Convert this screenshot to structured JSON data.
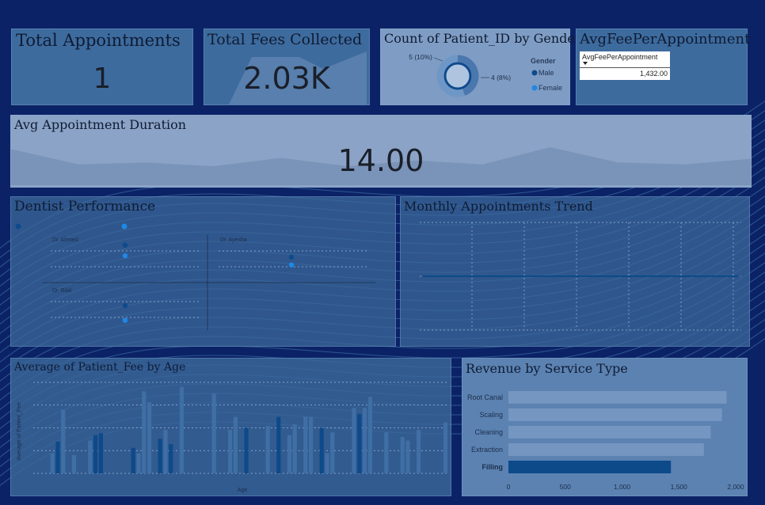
{
  "kpis": {
    "total_appointments": {
      "title": "Total Appointments",
      "value": "1"
    },
    "total_fees": {
      "title": "Total Fees Collected",
      "value": "2.03K"
    },
    "avg_duration": {
      "title": "Avg Appointment Duration",
      "value": "14.00"
    }
  },
  "avg_fee_card": {
    "title": "AvgFeePerAppointment",
    "table_header": "AvgFeePerAppointment",
    "sort_icon": "sort-desc-icon",
    "table_value": "1,432.00"
  },
  "colors": {
    "page_bg": "#0b2366",
    "card_bg": "#3d6b9e",
    "male": "#0e4a8c",
    "female": "#1f88e5",
    "bar": "#4f7cab",
    "bar_highlight": "#0d4a8a"
  },
  "chart_data": [
    {
      "type": "pie",
      "subtype": "donut",
      "title": "Count of Patient_ID by Gender",
      "legend_title": "Gender",
      "legend_position": "right",
      "categories": [
        "Male",
        "Female"
      ],
      "data_labels": [
        "4 (8%)",
        "5 (10%)"
      ],
      "values": [
        4,
        5
      ]
    },
    {
      "type": "bar",
      "orientation": "horizontal",
      "title": "Revenue by Service Type",
      "categories": [
        "Root Canal",
        "Scaling",
        "Cleaning",
        "Extraction",
        "Filling"
      ],
      "values": [
        1920,
        1880,
        1780,
        1720,
        1430
      ],
      "highlighted": "Filling",
      "xlim": [
        0,
        2000
      ],
      "xticks": [
        "0",
        "500",
        "1,000",
        "1,500",
        "2,000"
      ]
    },
    {
      "type": "bar",
      "title": "Average of Patient_Fee by Age",
      "xlabel": "Age",
      "ylabel": "Average of Patient_Fee",
      "grid": true,
      "values": [
        0,
        0,
        0,
        0,
        0,
        0,
        0,
        0,
        38,
        0,
        40,
        0,
        0,
        0,
        0,
        75,
        0,
        0,
        0,
        90,
        0,
        0,
        0,
        0,
        35,
        0,
        0,
        0,
        0,
        0,
        0,
        55,
        0,
        0,
        0,
        0,
        0,
        0,
        78,
        0,
        25,
        0,
        0,
        0,
        35,
        0,
        0,
        0,
        0,
        0,
        0,
        0,
        0,
        0,
        0,
        0,
        0,
        62,
        0,
        0,
        0,
        0,
        0,
        58,
        0,
        0,
        0,
        35,
        0,
        0,
        85,
        0,
        0,
        0,
        75,
        0,
        0,
        72,
        0,
        0,
        0,
        0,
        0,
        0,
        40,
        0,
        0,
        0,
        0,
        0,
        0,
        65,
        0,
        0,
        0,
        0,
        0,
        0,
        0,
        0,
        0,
        0,
        0,
        0,
        0,
        0,
        0,
        0,
        0,
        0,
        0,
        0,
        0,
        92
      ],
      "dark_values": [
        0,
        0,
        0,
        0,
        0,
        0,
        0,
        0,
        0,
        0,
        0,
        0,
        0,
        0,
        0,
        0,
        0,
        0,
        0,
        0,
        0,
        0,
        0,
        0,
        0,
        0,
        0,
        0,
        0,
        0,
        0,
        0,
        0,
        0,
        0,
        0,
        0,
        0,
        0,
        0,
        0,
        0,
        0,
        0,
        0,
        0,
        0,
        0,
        0,
        0,
        0,
        0,
        0,
        0,
        0,
        0,
        0,
        0,
        0,
        0,
        0,
        0,
        0,
        0,
        0,
        0,
        0,
        0,
        0,
        0,
        0,
        0,
        0,
        0,
        0,
        0,
        0,
        0,
        0,
        0,
        0,
        0,
        0,
        0,
        0,
        0,
        0,
        0,
        0,
        0,
        0,
        0,
        0,
        0,
        0,
        0,
        0,
        0,
        0,
        0,
        0,
        0,
        0,
        0,
        0,
        0,
        0,
        0,
        0,
        0,
        0,
        0,
        0,
        0
      ]
    },
    {
      "type": "line",
      "title": "Monthly Appointments Trend",
      "grid": true,
      "values": [
        1,
        1,
        1,
        1,
        1,
        1,
        1
      ]
    },
    {
      "type": "scatter",
      "title": "Dentist Performance",
      "panels": [
        {
          "name": "Dr. Ahmed",
          "points": [
            0.78,
            0.55
          ]
        },
        {
          "name": "Dr. Ayesha",
          "points": [
            0.52,
            0.35
          ]
        },
        {
          "name": "Dr. Bilal",
          "points": [
            0.55,
            0.22
          ]
        }
      ]
    },
    {
      "type": "area",
      "series_top": [
        0.95,
        0.55,
        0.6,
        0.5,
        0.72,
        0.5,
        0.65,
        0.55,
        1.0,
        0.6,
        0.55,
        0.7
      ]
    },
    {
      "type": "area",
      "series_top": [
        0.1,
        0.45,
        0.92,
        0.92,
        0.92
      ]
    }
  ]
}
